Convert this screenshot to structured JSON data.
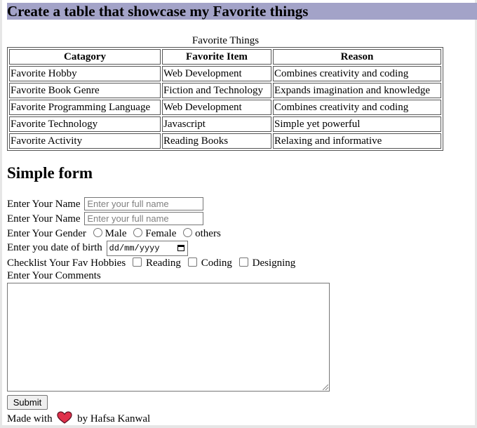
{
  "heading": "Create a table that showcase my Favorite things",
  "table": {
    "caption": "Favorite Things",
    "headers": [
      "Catagory",
      "Favorite Item",
      "Reason"
    ],
    "rows": [
      [
        "Favorite Hobby",
        "Web Development",
        "Combines creativity and coding"
      ],
      [
        "Favorite Book Genre",
        "Fiction and Technology",
        "Expands imagination and knowledge"
      ],
      [
        "Favorite Programming Language",
        "Web Development",
        "Combines creativity and coding"
      ],
      [
        "Favorite Technology",
        "Javascript",
        "Simple yet powerful"
      ],
      [
        "Favorite Activity",
        "Reading Books",
        "Relaxing and informative"
      ]
    ]
  },
  "form": {
    "title": "Simple form",
    "name1_label": "Enter Your Name",
    "name1_placeholder": "Enter your full name",
    "name2_label": "Enter Your Name",
    "name2_placeholder": "Enter your full name",
    "gender_label": "Enter Your Gender",
    "gender_options": [
      "Male",
      "Female",
      "others"
    ],
    "dob_label": "Enter you date of birth",
    "dob_placeholder": "dd/mm/yyyy",
    "hobbies_label": "Checklist Your Fav Hobbies",
    "hobby_options": [
      "Reading",
      "Coding",
      "Designing"
    ],
    "comments_label": "Enter Your Comments",
    "comments_value": "",
    "submit_label": "Submit"
  },
  "footer": {
    "made_with": "Made with",
    "by": "by Hafsa Kanwal",
    "heart_color": "#e0314b"
  }
}
